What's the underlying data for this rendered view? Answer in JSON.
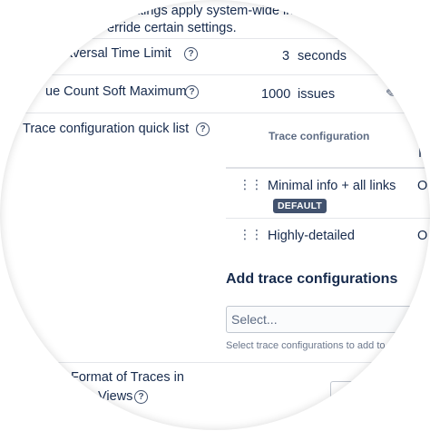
{
  "intro": {
    "line1": "ettings apply system-wide in",
    "line2": "erride certain settings."
  },
  "settings": [
    {
      "label": "aversal Time Limit",
      "value": "3",
      "unit": "seconds"
    },
    {
      "label": "ue Count Soft Maximum",
      "value": "1000",
      "unit": "issues"
    },
    {
      "label": "Trace configuration quick list"
    }
  ],
  "trace_table": {
    "header": "Trace configuration",
    "rows": [
      {
        "name": "Minimal info + all links",
        "badge": "DEFAULT",
        "trail": "O"
      },
      {
        "name": "Highly-detailed",
        "trail": "O"
      }
    ]
  },
  "add_section": {
    "title": "Add trace configurations",
    "select_placeholder": "Select...",
    "hint": "Select trace configurations to add to"
  },
  "format_setting": {
    "line1": "Format of Traces in",
    "line2": "Views"
  },
  "icons": {
    "help": "?"
  }
}
